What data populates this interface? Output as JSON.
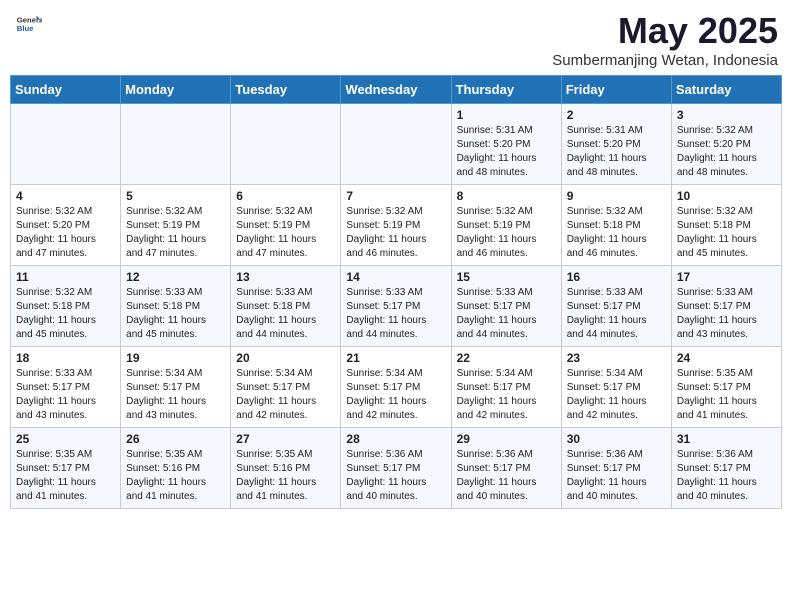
{
  "header": {
    "logo_general": "General",
    "logo_blue": "Blue",
    "month": "May 2025",
    "location": "Sumbermanjing Wetan, Indonesia"
  },
  "weekdays": [
    "Sunday",
    "Monday",
    "Tuesday",
    "Wednesday",
    "Thursday",
    "Friday",
    "Saturday"
  ],
  "weeks": [
    [
      {
        "day": "",
        "info": ""
      },
      {
        "day": "",
        "info": ""
      },
      {
        "day": "",
        "info": ""
      },
      {
        "day": "",
        "info": ""
      },
      {
        "day": "1",
        "info": "Sunrise: 5:31 AM\nSunset: 5:20 PM\nDaylight: 11 hours\nand 48 minutes."
      },
      {
        "day": "2",
        "info": "Sunrise: 5:31 AM\nSunset: 5:20 PM\nDaylight: 11 hours\nand 48 minutes."
      },
      {
        "day": "3",
        "info": "Sunrise: 5:32 AM\nSunset: 5:20 PM\nDaylight: 11 hours\nand 48 minutes."
      }
    ],
    [
      {
        "day": "4",
        "info": "Sunrise: 5:32 AM\nSunset: 5:20 PM\nDaylight: 11 hours\nand 47 minutes."
      },
      {
        "day": "5",
        "info": "Sunrise: 5:32 AM\nSunset: 5:19 PM\nDaylight: 11 hours\nand 47 minutes."
      },
      {
        "day": "6",
        "info": "Sunrise: 5:32 AM\nSunset: 5:19 PM\nDaylight: 11 hours\nand 47 minutes."
      },
      {
        "day": "7",
        "info": "Sunrise: 5:32 AM\nSunset: 5:19 PM\nDaylight: 11 hours\nand 46 minutes."
      },
      {
        "day": "8",
        "info": "Sunrise: 5:32 AM\nSunset: 5:19 PM\nDaylight: 11 hours\nand 46 minutes."
      },
      {
        "day": "9",
        "info": "Sunrise: 5:32 AM\nSunset: 5:18 PM\nDaylight: 11 hours\nand 46 minutes."
      },
      {
        "day": "10",
        "info": "Sunrise: 5:32 AM\nSunset: 5:18 PM\nDaylight: 11 hours\nand 45 minutes."
      }
    ],
    [
      {
        "day": "11",
        "info": "Sunrise: 5:32 AM\nSunset: 5:18 PM\nDaylight: 11 hours\nand 45 minutes."
      },
      {
        "day": "12",
        "info": "Sunrise: 5:33 AM\nSunset: 5:18 PM\nDaylight: 11 hours\nand 45 minutes."
      },
      {
        "day": "13",
        "info": "Sunrise: 5:33 AM\nSunset: 5:18 PM\nDaylight: 11 hours\nand 44 minutes."
      },
      {
        "day": "14",
        "info": "Sunrise: 5:33 AM\nSunset: 5:17 PM\nDaylight: 11 hours\nand 44 minutes."
      },
      {
        "day": "15",
        "info": "Sunrise: 5:33 AM\nSunset: 5:17 PM\nDaylight: 11 hours\nand 44 minutes."
      },
      {
        "day": "16",
        "info": "Sunrise: 5:33 AM\nSunset: 5:17 PM\nDaylight: 11 hours\nand 44 minutes."
      },
      {
        "day": "17",
        "info": "Sunrise: 5:33 AM\nSunset: 5:17 PM\nDaylight: 11 hours\nand 43 minutes."
      }
    ],
    [
      {
        "day": "18",
        "info": "Sunrise: 5:33 AM\nSunset: 5:17 PM\nDaylight: 11 hours\nand 43 minutes."
      },
      {
        "day": "19",
        "info": "Sunrise: 5:34 AM\nSunset: 5:17 PM\nDaylight: 11 hours\nand 43 minutes."
      },
      {
        "day": "20",
        "info": "Sunrise: 5:34 AM\nSunset: 5:17 PM\nDaylight: 11 hours\nand 42 minutes."
      },
      {
        "day": "21",
        "info": "Sunrise: 5:34 AM\nSunset: 5:17 PM\nDaylight: 11 hours\nand 42 minutes."
      },
      {
        "day": "22",
        "info": "Sunrise: 5:34 AM\nSunset: 5:17 PM\nDaylight: 11 hours\nand 42 minutes."
      },
      {
        "day": "23",
        "info": "Sunrise: 5:34 AM\nSunset: 5:17 PM\nDaylight: 11 hours\nand 42 minutes."
      },
      {
        "day": "24",
        "info": "Sunrise: 5:35 AM\nSunset: 5:17 PM\nDaylight: 11 hours\nand 41 minutes."
      }
    ],
    [
      {
        "day": "25",
        "info": "Sunrise: 5:35 AM\nSunset: 5:17 PM\nDaylight: 11 hours\nand 41 minutes."
      },
      {
        "day": "26",
        "info": "Sunrise: 5:35 AM\nSunset: 5:16 PM\nDaylight: 11 hours\nand 41 minutes."
      },
      {
        "day": "27",
        "info": "Sunrise: 5:35 AM\nSunset: 5:16 PM\nDaylight: 11 hours\nand 41 minutes."
      },
      {
        "day": "28",
        "info": "Sunrise: 5:36 AM\nSunset: 5:17 PM\nDaylight: 11 hours\nand 40 minutes."
      },
      {
        "day": "29",
        "info": "Sunrise: 5:36 AM\nSunset: 5:17 PM\nDaylight: 11 hours\nand 40 minutes."
      },
      {
        "day": "30",
        "info": "Sunrise: 5:36 AM\nSunset: 5:17 PM\nDaylight: 11 hours\nand 40 minutes."
      },
      {
        "day": "31",
        "info": "Sunrise: 5:36 AM\nSunset: 5:17 PM\nDaylight: 11 hours\nand 40 minutes."
      }
    ]
  ]
}
